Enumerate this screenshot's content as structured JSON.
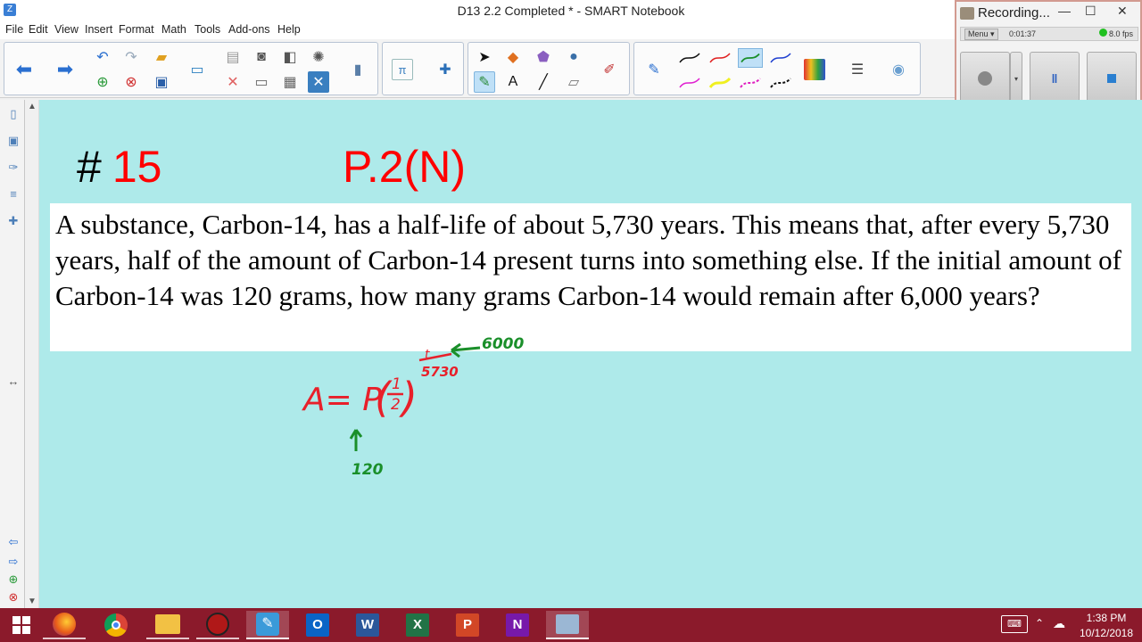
{
  "window": {
    "title": "D13 2.2 Completed * - SMART Notebook"
  },
  "menu": [
    "File",
    "Edit",
    "View",
    "Insert",
    "Format",
    "Math",
    "Tools",
    "Add-ons",
    "Help"
  ],
  "recorder": {
    "title": "Recording...",
    "menu_label": "Menu",
    "elapsed": "0:01:37",
    "fps": "8.0 fps",
    "minimize": "—",
    "maximize": "☐",
    "close": "✕"
  },
  "page": {
    "number_symbol": "#",
    "number": "15",
    "reference": "P.2(N)",
    "problem": "A substance, Carbon-14, has a half-life of about 5,730 years. This means that, after every 5,730 years, half of the amount of Carbon-14 present turns into something else. If the initial amount of Carbon-14 was 120 grams, how many grams Carbon-14 would remain after 6,000 years?"
  },
  "ink": {
    "formula": "A= P",
    "fraction_num": "1",
    "fraction_den": "2",
    "exponent_num": "t",
    "exponent_den": "5730",
    "t_value": "6000",
    "p_value": "120",
    "red": "#e8202a",
    "green": "#1a8f2a"
  },
  "taskbar": {
    "time": "1:38 PM",
    "date": "10/12/2018"
  },
  "colors": {
    "canvas": "#aeeaea",
    "taskbar": "#8b1a2b",
    "heading_red": "#ff0000"
  }
}
